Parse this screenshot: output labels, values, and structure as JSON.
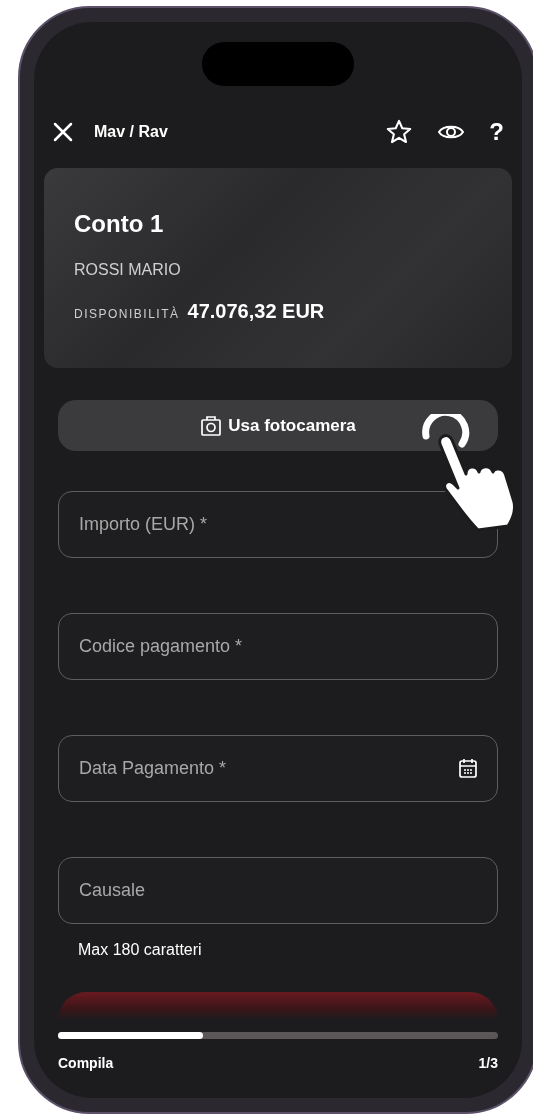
{
  "header": {
    "title": "Mav / Rav",
    "help_icon": "?"
  },
  "account_card": {
    "name": "Conto 1",
    "holder": "ROSSI MARIO",
    "balance_label": "DISPONIBILITÀ",
    "balance": "47.076,32 EUR"
  },
  "camera_button": {
    "label": "Usa fotocamera"
  },
  "fields": [
    {
      "kind": "text",
      "placeholder": "Importo (EUR) *"
    },
    {
      "kind": "text",
      "placeholder": "Codice pagamento *"
    },
    {
      "kind": "date",
      "placeholder": "Data Pagamento *"
    },
    {
      "kind": "text",
      "placeholder": "Causale",
      "helper": "Max 180 caratteri"
    }
  ],
  "progress": {
    "level": 0.33,
    "step_label": "Compila",
    "step_count": "1/3"
  }
}
